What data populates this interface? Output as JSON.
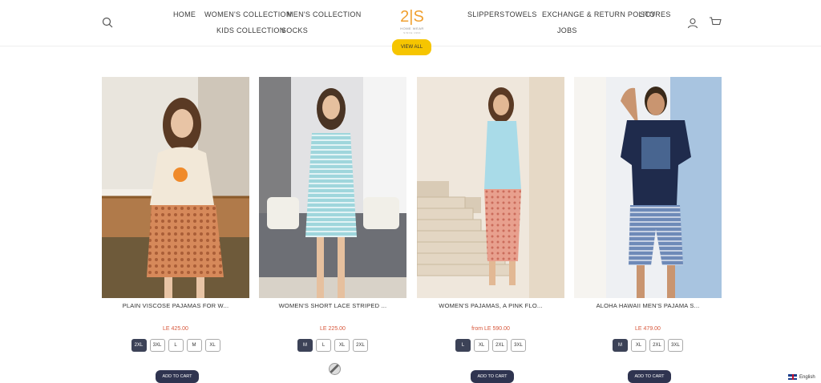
{
  "header": {
    "nav_left_row1": [
      "HOME",
      "WOMEN'S COLLECTION",
      "MEN'S COLLECTION"
    ],
    "nav_left_row2": [
      "KIDS COLLECTION",
      "SOCKS"
    ],
    "nav_right_row1": [
      "SLIPPERS",
      "TOWELS",
      "EXCHANGE & RETURN POLICY",
      "STORES"
    ],
    "nav_right_row2": [
      "JOBS"
    ],
    "logo": {
      "main": "2|S",
      "sub": "HOME WEAR",
      "sub2": "SINCE 1993"
    }
  },
  "view_all_label": "VIEW ALL",
  "products": [
    {
      "title": "PLAIN VISCOSE PAJAMAS FOR W...",
      "price": "LE 425.00",
      "sizes": [
        "2XL",
        "3XL",
        "L",
        "M",
        "XL"
      ],
      "selected": "2XL",
      "cta": "ADD TO CART"
    },
    {
      "title": "WOMEN'S SHORT LACE STRIPED ...",
      "price": "LE 225.00",
      "sizes": [
        "M",
        "L",
        "XL",
        "2XL"
      ],
      "selected": "M",
      "cta": ""
    },
    {
      "title": "WOMEN'S PAJAMAS, A PINK FLO...",
      "price": "from LE 590.00",
      "sizes": [
        "L",
        "XL",
        "2XL",
        "3XL"
      ],
      "selected": "L",
      "cta": "ADD TO CART"
    },
    {
      "title": "ALOHA HAWAII MEN'S PAJAMA S...",
      "price": "LE 479.00",
      "sizes": [
        "M",
        "XL",
        "2XL",
        "3XL"
      ],
      "selected": "M",
      "cta": "ADD TO CART"
    }
  ],
  "language": "English",
  "colors": {
    "accent": "#f6c500",
    "price": "#d7573b",
    "button": "#2f3450",
    "logo": "#f0a030"
  }
}
